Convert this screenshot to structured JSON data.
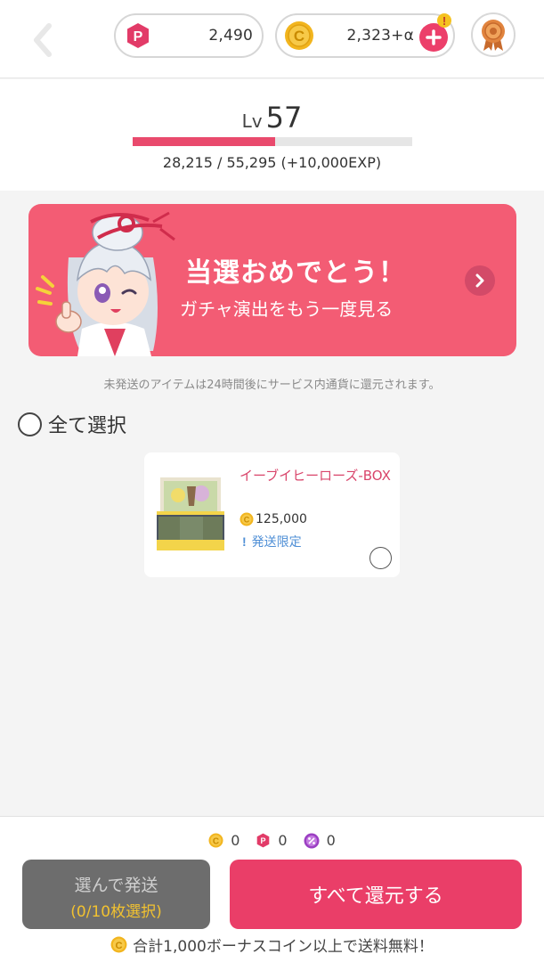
{
  "header": {
    "back_icon": "chevron-left-icon",
    "points": {
      "icon": "p-badge-icon",
      "amount": "2,490"
    },
    "coins": {
      "icon": "coin-icon",
      "amount": "2,323+α"
    },
    "avatar_icon": "bronze-medal-icon"
  },
  "level": {
    "label": "Lv",
    "number": "57",
    "exp_text": "28,215 / 55,295 (+10,000EXP)",
    "progress_fraction": 0.51
  },
  "banner": {
    "title": "当選おめでとう！",
    "subtitle": "ガチャ演出をもう一度見る"
  },
  "notice": "未発送のアイテムは24時間後にサービス内通貨に還元されます。",
  "select_all": {
    "label": "全て選択"
  },
  "items": [
    {
      "name": "イーブイヒーローズ-BOX",
      "price": "125,000",
      "tag": "発送限定"
    }
  ],
  "totals": {
    "coin": "0",
    "point": "0",
    "ticket": "0"
  },
  "buttons": {
    "ship_line1": "選んで発送",
    "ship_line2": "(0/10枚選択)",
    "return_all": "すべて還元する"
  },
  "footer_note": "合計1,000ボーナスコイン以上で送料無料！",
  "colors": {
    "accent_pink": "#ea3e68",
    "banner_pink": "#f35c74",
    "coin_gold": "#f2b51e",
    "tag_blue": "#4f8fd6",
    "ticket_purple": "#9b3fc2"
  }
}
